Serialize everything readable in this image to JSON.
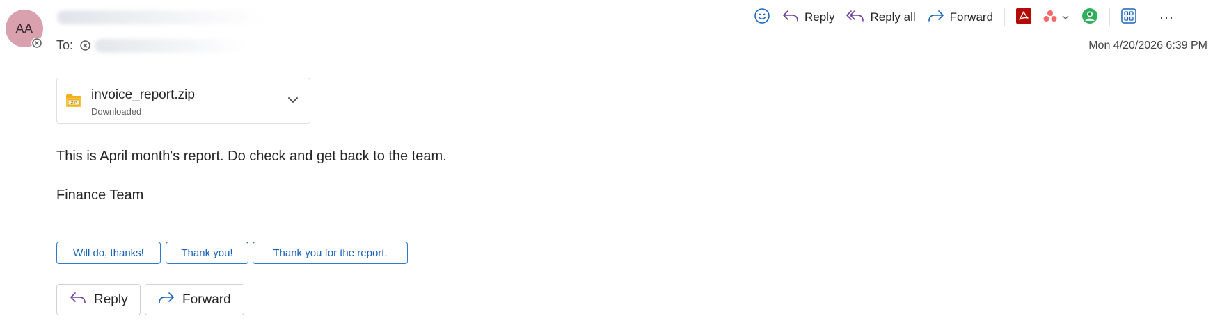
{
  "header": {
    "avatar_initials": "AA",
    "to_label": "To:",
    "timestamp": "Mon 4/20/2026 6:39 PM"
  },
  "toolbar": {
    "reply_label": "Reply",
    "reply_all_label": "Reply all",
    "forward_label": "Forward",
    "more_label": "···",
    "accent_color": "#6b3fa0",
    "link_color": "#1a62b8"
  },
  "attachment": {
    "file_name": "invoice_report.zip",
    "status": "Downloaded",
    "icon": "zip-folder-icon"
  },
  "message": {
    "line1": "This is April month's report. Do check and get back to the team.",
    "line2": "Finance Team"
  },
  "suggested_replies": [
    {
      "label": "Will do, thanks!"
    },
    {
      "label": "Thank you!"
    },
    {
      "label": "Thank you for the report."
    }
  ],
  "actions": {
    "reply_label": "Reply",
    "forward_label": "Forward"
  },
  "icons": {
    "emoji": "smiley-icon",
    "reply": "reply-arrow-icon",
    "reply_all": "reply-all-arrow-icon",
    "forward": "forward-arrow-icon",
    "pdf": "adobe-pdf-icon",
    "asana": "asana-icon",
    "loop": "green-circle-app-icon",
    "apps": "apps-grid-icon",
    "more": "more-dots-icon"
  }
}
